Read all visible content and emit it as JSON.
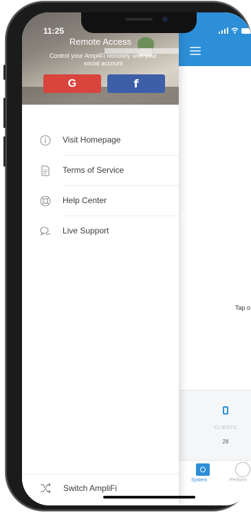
{
  "status_bar": {
    "time": "11:25"
  },
  "drawer": {
    "header": {
      "title": "Remote Access",
      "subtitle": "Control your AmpliFi remotely with your social account",
      "google_label": "G",
      "facebook_label": "f"
    },
    "menu": [
      {
        "label": "Visit Homepage",
        "icon": "info-icon"
      },
      {
        "label": "Terms of Service",
        "icon": "document-icon"
      },
      {
        "label": "Help Center",
        "icon": "lifebuoy-icon"
      },
      {
        "label": "Live Support",
        "icon": "chat-bubbles-icon"
      }
    ],
    "footer": {
      "label": "Switch AmpliFi",
      "icon": "shuffle-icon"
    }
  },
  "app": {
    "header_color": "#2d8fd8",
    "tap_hint": "Tap o",
    "clients": {
      "label": "CLIENTS",
      "value": "28"
    },
    "tabs": [
      {
        "label": "System",
        "active": true
      },
      {
        "label": "Perform",
        "active": false
      }
    ]
  }
}
